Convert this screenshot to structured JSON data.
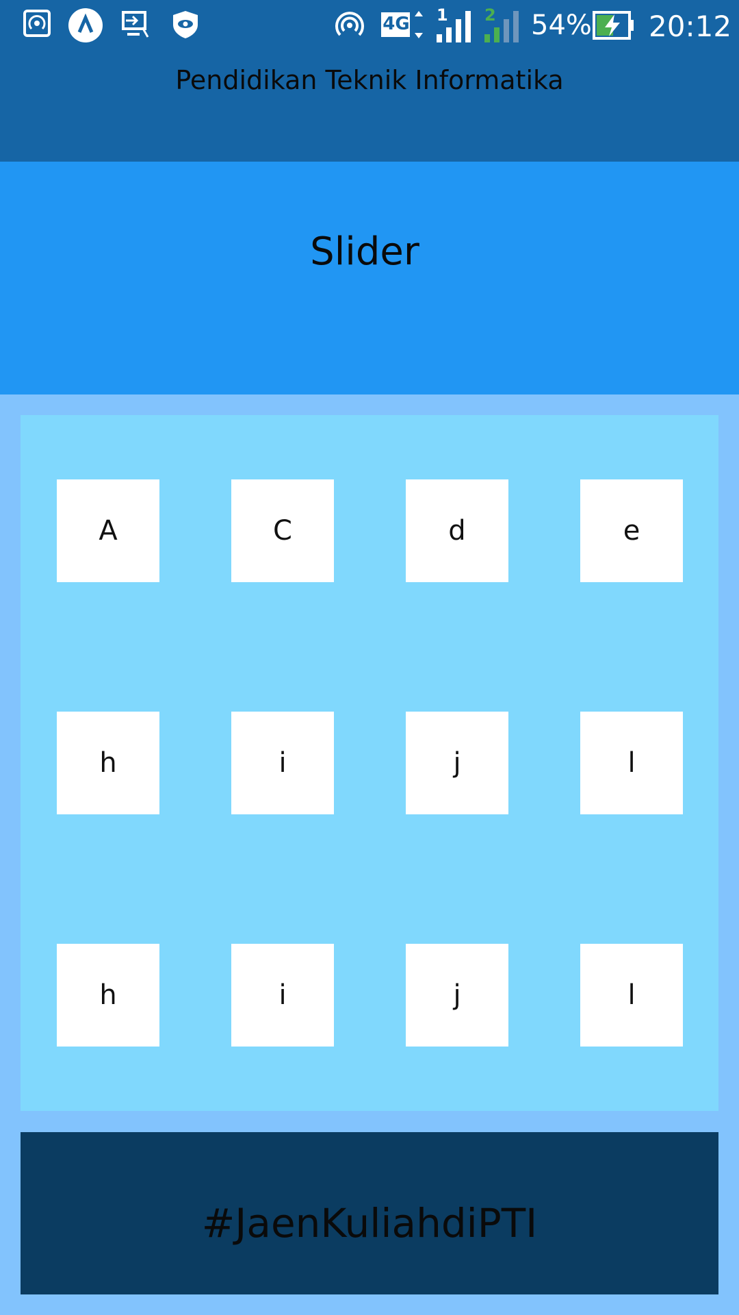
{
  "status_bar": {
    "icons": [
      "hotspot-icon",
      "app-a-icon",
      "cast-icon",
      "shield-eye-icon",
      "wifi-tethering-icon",
      "network-4g-icon",
      "sim1-signal-icon",
      "sim2-signal-icon",
      "battery-charging-icon"
    ],
    "network": "4G",
    "sim1": "1",
    "sim2": "2",
    "battery": "54%",
    "time": "20:12"
  },
  "header": {
    "title": "Pendidikan Teknik Informatika"
  },
  "slider": {
    "label": "Slider"
  },
  "grid": {
    "rows": [
      [
        "A",
        "C",
        "d",
        "e"
      ],
      [
        "h",
        "i",
        "j",
        "l"
      ],
      [
        "h",
        "i",
        "j",
        "l"
      ]
    ]
  },
  "footer": {
    "text": "#JaenKuliahdiPTI"
  },
  "colors": {
    "header": "#1665a5",
    "slider": "#2196f3",
    "page": "#82c3fd",
    "grid": "#80d8fd",
    "footer": "#0b3c61",
    "tile": "#ffffff",
    "battery_fill": "#4caf50",
    "sim2": "#4caf50"
  }
}
